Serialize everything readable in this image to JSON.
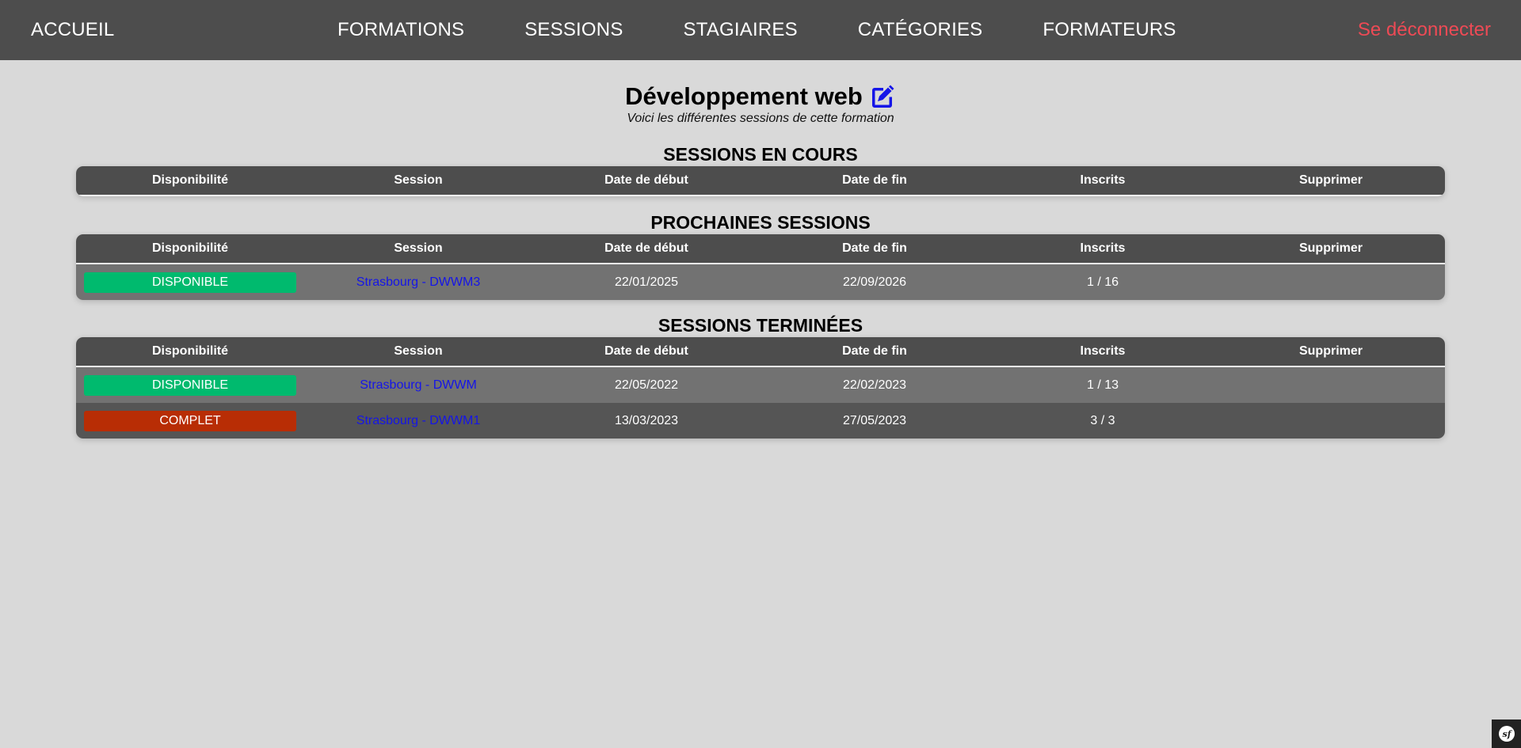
{
  "nav": {
    "home": "ACCUEIL",
    "items": [
      "FORMATIONS",
      "SESSIONS",
      "STAGIAIRES",
      "CATÉGORIES",
      "FORMATEURS"
    ],
    "logout": "Se déconnecter",
    "logout_color": "#ee4a55"
  },
  "page": {
    "title": "Développement web",
    "subtitle": "Voici les différentes sessions de cette formation",
    "edit_icon": "edit-icon"
  },
  "columns": [
    "Disponibilité",
    "Session",
    "Date de début",
    "Date de fin",
    "Inscrits",
    "Supprimer"
  ],
  "sections": [
    {
      "title": "SESSIONS EN COURS",
      "rows": []
    },
    {
      "title": "PROCHAINES SESSIONS",
      "rows": [
        {
          "status": "DISPONIBLE",
          "status_color": "#00ba6e",
          "session": "Strasbourg - DWWM3",
          "start": "22/01/2025",
          "end": "22/09/2026",
          "enrolled": "1 / 16"
        }
      ]
    },
    {
      "title": "SESSIONS TERMINÉES",
      "rows": [
        {
          "status": "DISPONIBLE",
          "status_color": "#00ba6e",
          "session": "Strasbourg - DWWM",
          "start": "22/05/2022",
          "end": "22/02/2023",
          "enrolled": "1 / 13"
        },
        {
          "status": "COMPLET",
          "status_color": "#b82d05",
          "session": "Strasbourg - DWWM1",
          "start": "13/03/2023",
          "end": "27/05/2023",
          "enrolled": "3 / 3"
        }
      ]
    }
  ],
  "colors": {
    "nav_bg": "#4d4d4d",
    "page_bg": "#d9d9d9",
    "link": "#1515e8"
  },
  "symfony_toolbar_icon": "symfony-icon"
}
